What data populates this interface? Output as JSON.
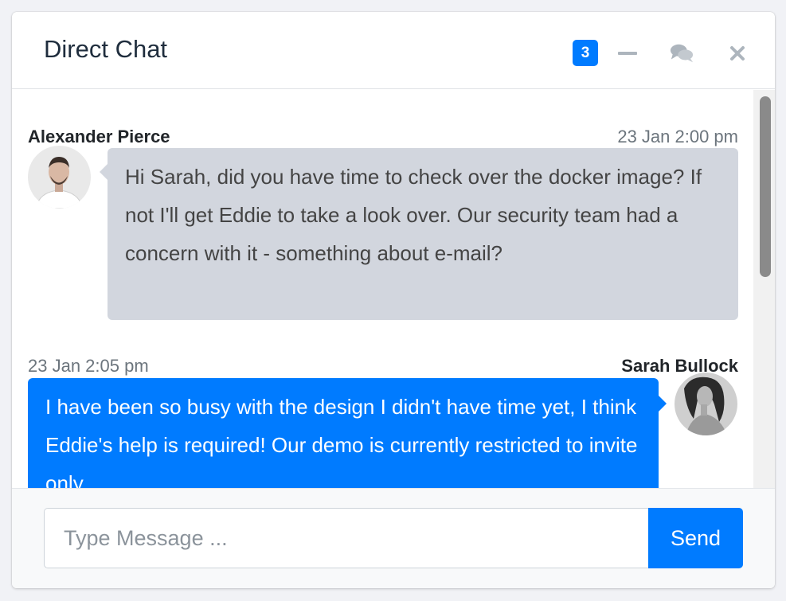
{
  "header": {
    "title": "Direct Chat",
    "badge_count": "3",
    "tools": [
      "minus-icon",
      "comments-icon",
      "close-icon"
    ]
  },
  "messages": [
    {
      "author": "Alexander Pierce",
      "timestamp": "23 Jan 2:00 pm",
      "text": "Hi Sarah, did you have time to check over the docker image? If not I'll get Eddie to take a look over. Our security team had a concern with it - something about e-mail?",
      "side": "left"
    },
    {
      "author": "Sarah Bullock",
      "timestamp": "23 Jan 2:05 pm",
      "text": "I have been so busy with the design I didn't have time yet, I think Eddie's help is required! Our demo is currently restricted to invite only.",
      "side": "right"
    }
  ],
  "footer": {
    "input_placeholder": "Type Message ...",
    "input_value": "",
    "send_label": "Send"
  },
  "colors": {
    "primary": "#007bff",
    "bubble_left": "#d2d6de",
    "text_muted": "#6c757d"
  }
}
